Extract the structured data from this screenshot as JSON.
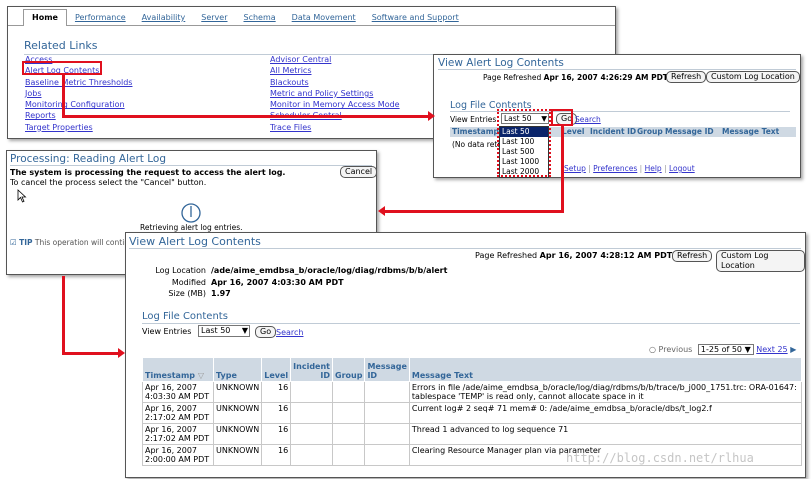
{
  "panel1": {
    "tabs": [
      "Home",
      "Performance",
      "Availability",
      "Server",
      "Schema",
      "Data Movement",
      "Software and Support"
    ],
    "related_links_title": "Related Links",
    "left_links": [
      "Access",
      "Alert Log Contents",
      "Baseline Metric Thresholds",
      "Jobs",
      "Monitoring Configuration",
      "Reports",
      "Target Properties"
    ],
    "right_links": [
      "Advisor Central",
      "All Metrics",
      "Blackouts",
      "Metric and Policy Settings",
      "Monitor in Memory Access Mode",
      "Scheduler Central",
      "Trace Files"
    ]
  },
  "panel2": {
    "title": "View Alert Log Contents",
    "page_refreshed_label": "Page Refreshed",
    "page_refreshed_value": "Apr 16, 2007 4:26:29 AM PDT",
    "refresh_button": "Refresh",
    "custom_button": "Custom Log Location",
    "section_title": "Log File Contents",
    "view_entries_label": "View Entries",
    "view_entries_value": "Last 50",
    "go_button": "Go",
    "search_link": "Search",
    "dropdown_options": [
      "Last 50",
      "Last 100",
      "Last 500",
      "Last 1000",
      "Last 2000"
    ],
    "columns": [
      "Timestamp",
      "Level",
      "Incident ID",
      "Group",
      "Message ID",
      "Message Text"
    ],
    "no_data": "(No data retri",
    "footer_links": [
      "Setup",
      "Preferences",
      "Help",
      "Logout"
    ]
  },
  "panel3": {
    "title": "Processing: Reading Alert Log",
    "bold_line": "The system is processing the request to access the alert log.",
    "cancel_hint": "To cancel the process select the \"Cancel\" button.",
    "cancel_button": "Cancel",
    "retrieving": "Retrieving alert log entries.",
    "tip_label": "TIP",
    "tip_text": "This operation will contin"
  },
  "panel4": {
    "title": "View Alert Log Contents",
    "page_refreshed_label": "Page Refreshed",
    "page_refreshed_value": "Apr 16, 2007 4:28:12 AM PDT",
    "refresh_button": "Refresh",
    "custom_button": "Custom Log Location",
    "log_location_label": "Log Location",
    "log_location_value": "/ade/aime_emdbsa_b/oracle/log/diag/rdbms/b/b/alert",
    "modified_label": "Modified",
    "modified_value": "Apr 16, 2007 4:03:30 AM PDT",
    "size_label": "Size (MB)",
    "size_value": "1.97",
    "section_title": "Log File Contents",
    "view_entries_label": "View Entries",
    "view_entries_value": "Last 50",
    "go_button": "Go",
    "search_link": "Search",
    "previous": "Previous",
    "range": "1-25 of 50",
    "next": "Next 25",
    "columns": [
      "Timestamp",
      "Type",
      "Level",
      "Incident ID",
      "Group",
      "Message ID",
      "Message Text"
    ],
    "rows": [
      {
        "ts1": "Apr 16, 2007",
        "ts2": "4:03:30 AM PDT",
        "type": "UNKNOWN",
        "level": "16",
        "msg": "Errors in file /ade/aime_emdbsa_b/oracle/log/diag/rdbms/b/b/trace/b_j000_1751.trc: ORA-01647: tablespace 'TEMP' is read only, cannot allocate space in it"
      },
      {
        "ts1": "Apr 16, 2007",
        "ts2": "2:17:02 AM PDT",
        "type": "UNKNOWN",
        "level": "16",
        "msg": "Current log# 2 seq# 71 mem# 0: /ade/aime_emdbsa_b/oracle/dbs/t_log2.f"
      },
      {
        "ts1": "Apr 16, 2007",
        "ts2": "2:17:02 AM PDT",
        "type": "UNKNOWN",
        "level": "16",
        "msg": "Thread 1 advanced to log sequence 71"
      },
      {
        "ts1": "Apr 16, 2007",
        "ts2": "2:00:00 AM PDT",
        "type": "UNKNOWN",
        "level": "16",
        "msg": "Clearing Resource Manager plan via parameter"
      }
    ]
  },
  "watermark": "http://blog.csdn.net/rlhua",
  "colors": {
    "accent": "#336699",
    "link": "#3333cc",
    "annotation": "#e0101e",
    "header_bg": "#cfd9e3"
  }
}
